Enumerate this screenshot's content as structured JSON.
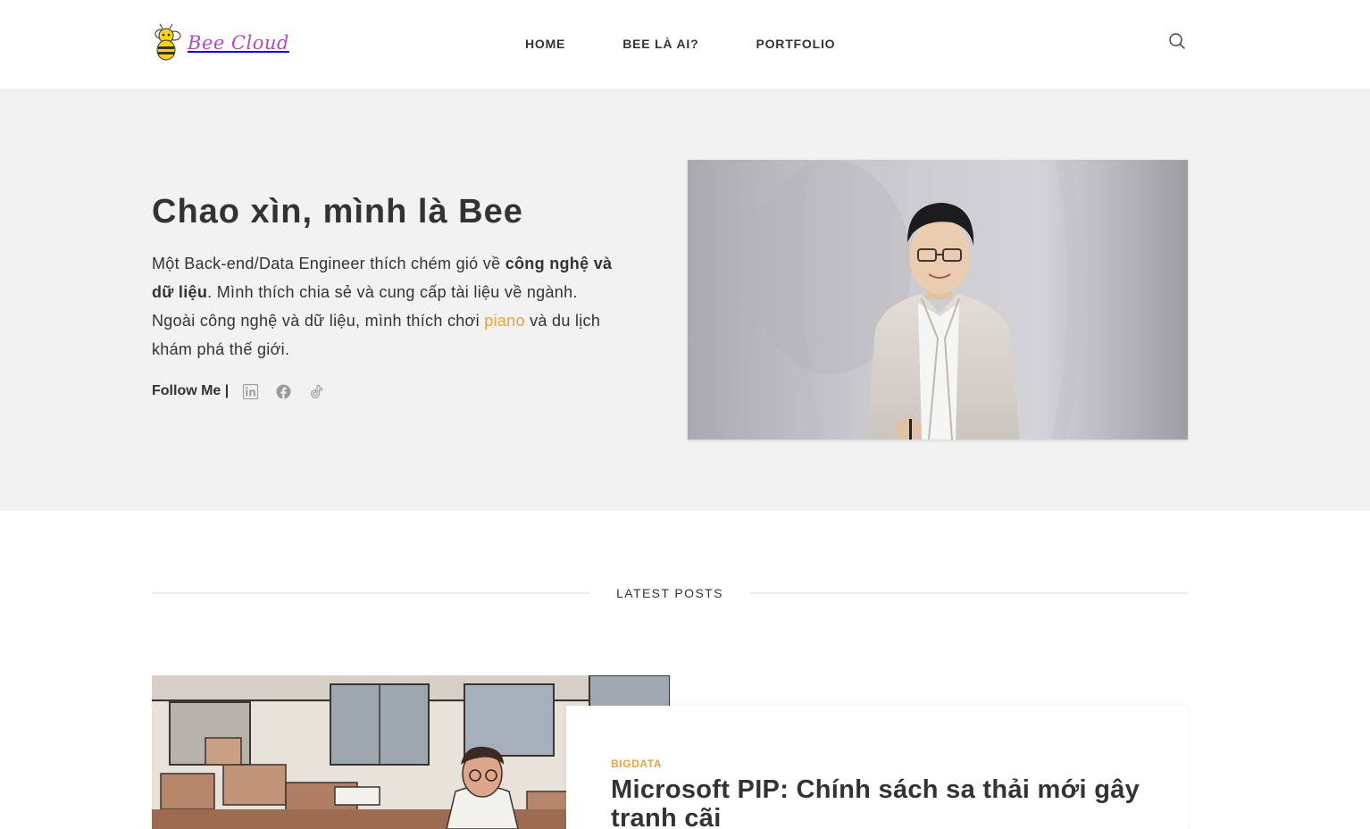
{
  "header": {
    "logo_text": "Bee Cloud",
    "nav": [
      {
        "label": "HOME"
      },
      {
        "label": "BEE LÀ AI?"
      },
      {
        "label": "PORTFOLIO"
      }
    ],
    "search_icon": "search-icon"
  },
  "hero": {
    "title_prefix": "Chao xìn, mình là ",
    "title_name": "Bee",
    "desc_1": "Một Back-end/Data Engineer thích chém gió về ",
    "desc_bold": "công nghệ và dữ liệu",
    "desc_2": ". Mình thích chia sẻ và cung cấp tài liệu về ngành. Ngoài công nghệ và dữ liệu, mình thích chơi ",
    "desc_link": "piano",
    "desc_3": " và du lịch khám phá thế giới.",
    "follow_label": "Follow Me |",
    "social": [
      "linkedin-icon",
      "facebook-icon",
      "tiktok-icon"
    ]
  },
  "latest": {
    "heading": "LATEST POSTS",
    "post": {
      "category": "BIGDATA",
      "title": "Microsoft PIP: Chính sách sa thải mới gây tranh cãi"
    }
  },
  "colors": {
    "accent": "#e8a33a",
    "logo": "#b548c6",
    "hero_bg": "#f2f2f2",
    "text": "#333333"
  }
}
